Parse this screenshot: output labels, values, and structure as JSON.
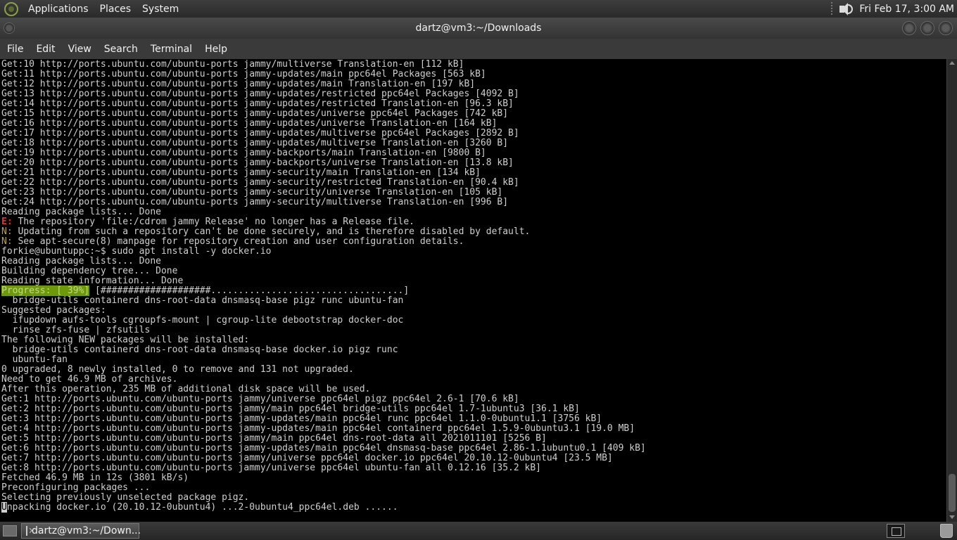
{
  "top_panel": {
    "menus": [
      "Applications",
      "Places",
      "System"
    ],
    "clock": "Fri Feb 17,  3:00 AM"
  },
  "window": {
    "title": "dartz@vm3:~/Downloads"
  },
  "menubar": [
    "File",
    "Edit",
    "View",
    "Search",
    "Terminal",
    "Help"
  ],
  "terminal": {
    "lines": [
      {
        "text": "Get:10 http://ports.ubuntu.com/ubuntu-ports jammy/multiverse Translation-en [112 kB]"
      },
      {
        "text": "Get:11 http://ports.ubuntu.com/ubuntu-ports jammy-updates/main ppc64el Packages [563 kB]"
      },
      {
        "text": "Get:12 http://ports.ubuntu.com/ubuntu-ports jammy-updates/main Translation-en [197 kB]"
      },
      {
        "text": "Get:13 http://ports.ubuntu.com/ubuntu-ports jammy-updates/restricted ppc64el Packages [4092 B]"
      },
      {
        "text": "Get:14 http://ports.ubuntu.com/ubuntu-ports jammy-updates/restricted Translation-en [96.3 kB]"
      },
      {
        "text": "Get:15 http://ports.ubuntu.com/ubuntu-ports jammy-updates/universe ppc64el Packages [742 kB]"
      },
      {
        "text": "Get:16 http://ports.ubuntu.com/ubuntu-ports jammy-updates/universe Translation-en [164 kB]"
      },
      {
        "text": "Get:17 http://ports.ubuntu.com/ubuntu-ports jammy-updates/multiverse ppc64el Packages [2892 B]"
      },
      {
        "text": "Get:18 http://ports.ubuntu.com/ubuntu-ports jammy-updates/multiverse Translation-en [3260 B]"
      },
      {
        "text": "Get:19 http://ports.ubuntu.com/ubuntu-ports jammy-backports/main Translation-en [9800 B]"
      },
      {
        "text": "Get:20 http://ports.ubuntu.com/ubuntu-ports jammy-backports/universe Translation-en [13.8 kB]"
      },
      {
        "text": "Get:21 http://ports.ubuntu.com/ubuntu-ports jammy-security/main Translation-en [134 kB]"
      },
      {
        "text": "Get:22 http://ports.ubuntu.com/ubuntu-ports jammy-security/restricted Translation-en [90.4 kB]"
      },
      {
        "text": "Get:23 http://ports.ubuntu.com/ubuntu-ports jammy-security/universe Translation-en [105 kB]"
      },
      {
        "text": "Get:24 http://ports.ubuntu.com/ubuntu-ports jammy-security/multiverse Translation-en [996 B]"
      },
      {
        "text": "Reading package lists... Done"
      },
      {
        "prefix": "E:",
        "kind": "err",
        "text": " The repository 'file:/cdrom jammy Release' no longer has a Release file."
      },
      {
        "prefix": "N:",
        "kind": "note",
        "text": " Updating from such a repository can't be done securely, and is therefore disabled by default."
      },
      {
        "prefix": "N:",
        "kind": "note",
        "text": " See apt-secure(8) manpage for repository creation and user configuration details."
      },
      {
        "text": "forkie@ubuntuppc:~$ sudo apt install -y docker.io"
      },
      {
        "text": "Reading package lists... Done"
      },
      {
        "text": "Building dependency tree... Done"
      },
      {
        "text": "Reading state information... Done"
      },
      {
        "prefix": "Progress: [ 39%]",
        "kind": "progress",
        "text": " [####################...................................]"
      },
      {
        "text": "  bridge-utils containerd dns-root-data dnsmasq-base pigz runc ubuntu-fan"
      },
      {
        "text": "Suggested packages:"
      },
      {
        "text": "  ifupdown aufs-tools cgroupfs-mount | cgroup-lite debootstrap docker-doc"
      },
      {
        "text": "  rinse zfs-fuse | zfsutils"
      },
      {
        "text": "The following NEW packages will be installed:"
      },
      {
        "text": "  bridge-utils containerd dns-root-data dnsmasq-base docker.io pigz runc"
      },
      {
        "text": "  ubuntu-fan"
      },
      {
        "text": "0 upgraded, 8 newly installed, 0 to remove and 131 not upgraded."
      },
      {
        "text": "Need to get 46.9 MB of archives."
      },
      {
        "text": "After this operation, 235 MB of additional disk space will be used."
      },
      {
        "text": "Get:1 http://ports.ubuntu.com/ubuntu-ports jammy/universe ppc64el pigz ppc64el 2.6-1 [70.6 kB]"
      },
      {
        "text": "Get:2 http://ports.ubuntu.com/ubuntu-ports jammy/main ppc64el bridge-utils ppc64el 1.7-1ubuntu3 [36.1 kB]"
      },
      {
        "text": "Get:3 http://ports.ubuntu.com/ubuntu-ports jammy-updates/main ppc64el runc ppc64el 1.1.0-0ubuntu1.1 [3756 kB]"
      },
      {
        "text": "Get:4 http://ports.ubuntu.com/ubuntu-ports jammy-updates/main ppc64el containerd ppc64el 1.5.9-0ubuntu3.1 [19.0 MB]"
      },
      {
        "text": "Get:5 http://ports.ubuntu.com/ubuntu-ports jammy/main ppc64el dns-root-data all 2021011101 [5256 B]"
      },
      {
        "text": "Get:6 http://ports.ubuntu.com/ubuntu-ports jammy-updates/main ppc64el dnsmasq-base ppc64el 2.86-1.1ubuntu0.1 [409 kB]"
      },
      {
        "text": "Get:7 http://ports.ubuntu.com/ubuntu-ports jammy/universe ppc64el docker.io ppc64el 20.10.12-0ubuntu4 [23.5 MB]"
      },
      {
        "text": "Get:8 http://ports.ubuntu.com/ubuntu-ports jammy/universe ppc64el ubuntu-fan all 0.12.16 [35.2 kB]"
      },
      {
        "text": "Fetched 46.9 MB in 12s (3801 kB/s)"
      },
      {
        "text": "Preconfiguring packages ..."
      },
      {
        "text": "Selecting previously unselected package pigz."
      },
      {
        "prefix": "U",
        "kind": "cursor",
        "text": "npacking docker.io (20.10.12-0ubuntu4) ...2-0ubuntu4_ppc64el.deb ......"
      }
    ]
  },
  "taskbar": {
    "task_label": "dartz@vm3:~/Down..."
  },
  "colors": {
    "error": "#e03232",
    "note": "#b3a24a",
    "progress_bg": "#6e9a0a"
  }
}
